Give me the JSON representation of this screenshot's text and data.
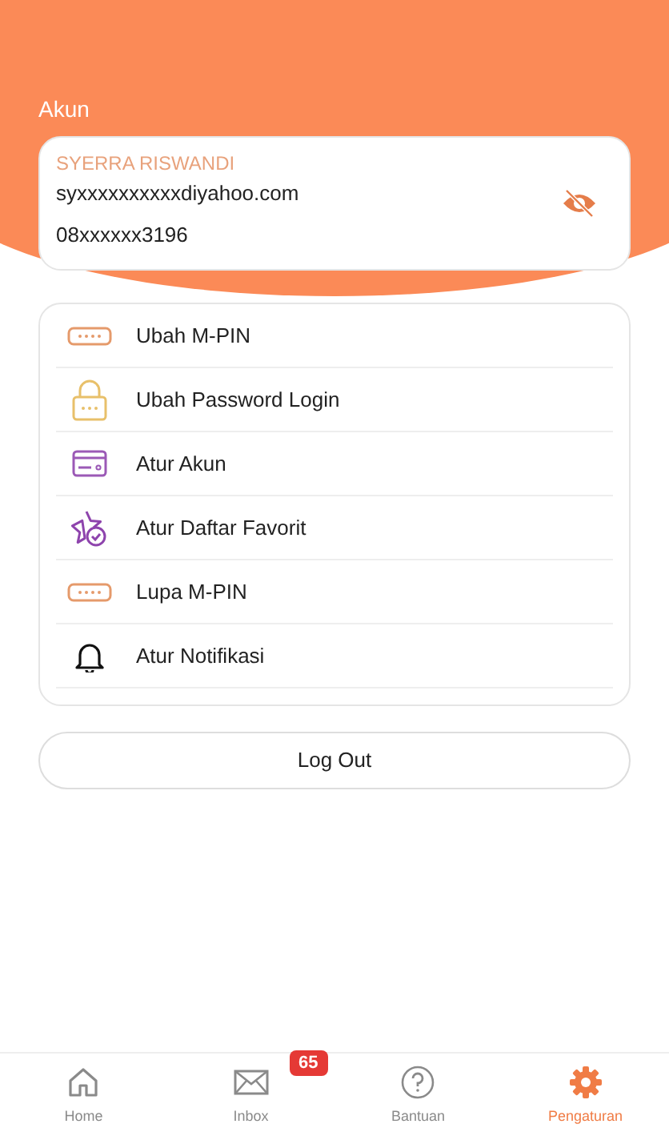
{
  "header": {
    "title": "Akun"
  },
  "profile": {
    "name": "SYERRA RISWANDI",
    "email": "syxxxxxxxxxxdiyahoo.com",
    "phone": "08xxxxxx3196"
  },
  "menu": [
    {
      "kind": "pin",
      "label": "Ubah M-PIN"
    },
    {
      "kind": "lock",
      "label": "Ubah Password Login"
    },
    {
      "kind": "card",
      "label": "Atur Akun"
    },
    {
      "kind": "star",
      "label": "Atur Daftar Favorit"
    },
    {
      "kind": "pin",
      "label": "Lupa M-PIN"
    },
    {
      "kind": "bell",
      "label": "Atur Notifikasi"
    }
  ],
  "logout": "Log Out",
  "nav": [
    {
      "kind": "home",
      "label": "Home",
      "selected": false
    },
    {
      "kind": "inbox",
      "label": "Inbox",
      "selected": false,
      "badge": "65"
    },
    {
      "kind": "help",
      "label": "Bantuan",
      "selected": false
    },
    {
      "kind": "settings",
      "label": "Pengaturan",
      "selected": true
    }
  ]
}
